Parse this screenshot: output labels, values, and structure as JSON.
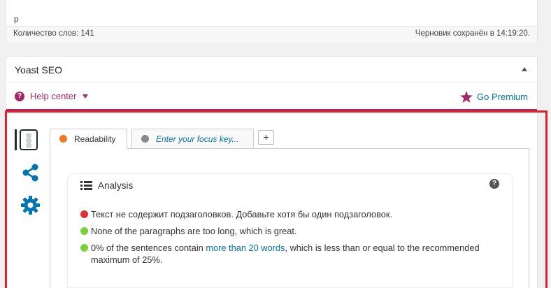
{
  "editor": {
    "path": "p",
    "word_count": "Количество слов: 141",
    "draft_status": "Черновик сохранён в 14:19:20."
  },
  "yoast": {
    "title": "Yoast SEO",
    "help_center": "Help center",
    "go_premium": "Go Premium",
    "tabs": [
      {
        "label": "Readability",
        "color": "#ee7c1b"
      },
      {
        "label": "Enter your focus key...",
        "color": "#888888"
      }
    ],
    "add_tab": "+",
    "analysis": {
      "heading": "Analysis",
      "help": "?",
      "results": [
        {
          "text": "Текст не содержит подзаголовков. Добавьте хотя бы один подзаголовок.",
          "color": "#dc3232"
        },
        {
          "text": "None of the paragraphs are too long, which is great.",
          "color": "#7ad03a"
        },
        {
          "before": "0% of the sentences contain ",
          "link": "more than 20 words",
          "after": ", which is less than or equal to the recommended maximum of 25%.",
          "color": "#7ad03a"
        }
      ]
    }
  },
  "colors": {
    "brand": "#a4286a",
    "link": "#0073aa",
    "highlight": "#e3202b",
    "icon_blue": "#0075b3"
  }
}
